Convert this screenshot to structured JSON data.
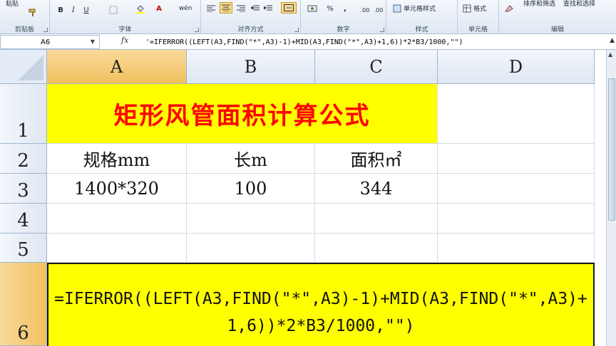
{
  "ribbon": {
    "paste_label": "粘贴",
    "clipboard_label": "剪贴板",
    "font_label": "字体",
    "bold": "B",
    "italic": "I",
    "underline": "U",
    "font_color": "A",
    "phonetic": "wén",
    "alignment_label": "对齐方式",
    "number_label": "数字",
    "percent": "%",
    "comma": ",",
    "dec_inc": ".00",
    "dec_dec": ".00",
    "styles_label": "样式",
    "cell_styles": "单元格样式",
    "cells_label": "单元格",
    "format_btn": "格式",
    "editing_label": "编辑",
    "sort_filter": "排序和筛选",
    "find_select": "查找和选择"
  },
  "formula_bar": {
    "name_box": "A6",
    "fx": "fx",
    "formula": "'=IFERROR((LEFT(A3,FIND(\"*\",A3)-1)+MID(A3,FIND(\"*\",A3)+1,6))*2*B3/1000,\"\")"
  },
  "columns": [
    "A",
    "B",
    "C",
    "D"
  ],
  "rows": [
    "1",
    "2",
    "3",
    "4",
    "5",
    "6"
  ],
  "cells": {
    "title": "矩形风管面积计算公式",
    "a2": "规格mm",
    "b2": "长m",
    "c2": "面积㎡",
    "a3": "1400*320",
    "b3": "100",
    "c3": "344",
    "a6": "=IFERROR((LEFT(A3,FIND(\"*\",A3)-1)+MID(A3,FIND(\"*\",A3)+1,6))*2*B3/1000,\"\")"
  },
  "colors": {
    "title_fill": "#ffff00",
    "title_text": "#ff0000",
    "formula_fill": "#ffff00"
  }
}
